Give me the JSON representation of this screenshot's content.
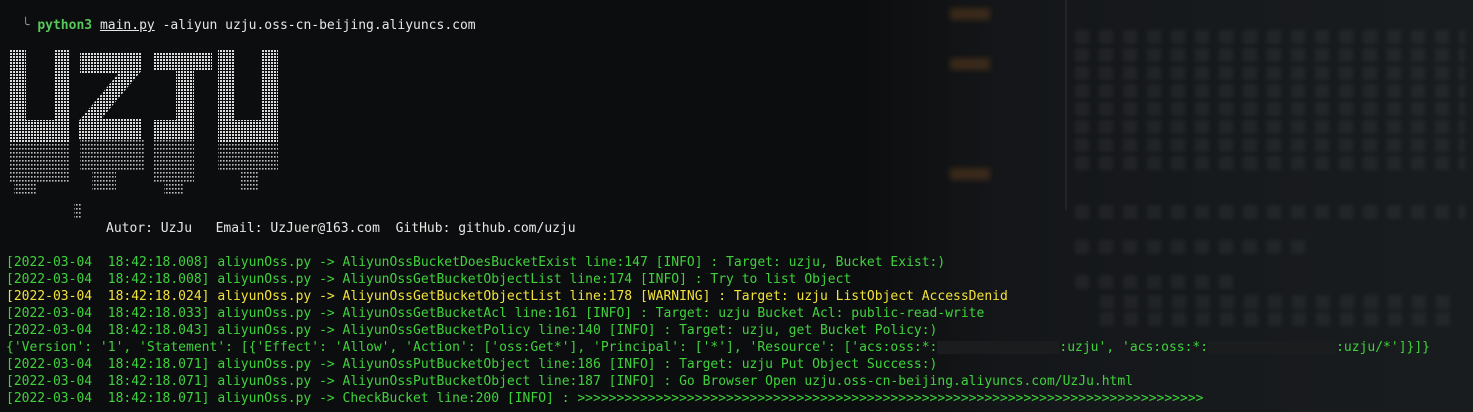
{
  "command": {
    "program": "python3",
    "file": "main.py",
    "args": "-aliyun uzju.oss-cn-beijing.aliyuncs.com"
  },
  "banner": {
    "logo_text": "UZJU",
    "autor_label": "Autor: UzJu",
    "email_label": "Email: UzJuer@163.com",
    "github_label": "GitHub: github.com/uzju"
  },
  "colors": {
    "info": "#3fd23c",
    "warning": "#f2e23a",
    "background": "#0c0d0e",
    "logo": "#d8d8d8"
  },
  "log_lines": [
    {
      "text": "[2022-03-04  18:42:18.008] aliyunOss.py -> AliyunOssBucketDoesBucketExist line:147 [INFO] : Target: uzju, Bucket Exist:)",
      "level": "info"
    },
    {
      "text": "[2022-03-04  18:42:18.008] aliyunOss.py -> AliyunOssGetBucketObjectList line:174 [INFO] : Try to list Object",
      "level": "info"
    },
    {
      "text": "[2022-03-04  18:42:18.024] aliyunOss.py -> AliyunOssGetBucketObjectList line:178 [WARNING] : Target: uzju ListObject AccessDenid",
      "level": "warning"
    },
    {
      "text": "[2022-03-04  18:42:18.033] aliyunOss.py -> AliyunOssGetBucketAcl line:161 [INFO] : Target: uzju Bucket Acl: public-read-write",
      "level": "info"
    },
    {
      "text": "[2022-03-04  18:42:18.043] aliyunOss.py -> AliyunOssGetBucketPolicy line:140 [INFO] : Target: uzju, get Bucket Policy:)",
      "level": "info"
    }
  ],
  "policy_line": {
    "part1": "{'Version': '1', 'Statement': [{'Effect': 'Allow', 'Action': ['oss:Get*'], 'Principal': ['*'], 'Resource': ['acs:oss:*:",
    "part2": ":uzju', 'acs:oss:*:",
    "part3": ":uzju/*']}]}"
  },
  "log_lines_after": [
    {
      "text": "[2022-03-04  18:42:18.071] aliyunOss.py -> AliyunOssPutBucketObject line:186 [INFO] : Target: uzju Put Object Success:)",
      "level": "info"
    },
    {
      "text": "[2022-03-04  18:42:18.071] aliyunOss.py -> AliyunOssPutBucketObject line:187 [INFO] : Go Browser Open uzju.oss-cn-beijing.aliyuncs.com/UzJu.html",
      "level": "info"
    },
    {
      "text": "[2022-03-04  18:42:18.071] aliyunOss.py -> CheckBucket line:200 [INFO] : >>>>>>>>>>>>>>>>>>>>>>>>>>>>>>>>>>>>>>>>>>>>>>>>>>>>>>>>>>>>>>>>>>>>>>>>>>>>>>>>",
      "level": "info"
    }
  ]
}
